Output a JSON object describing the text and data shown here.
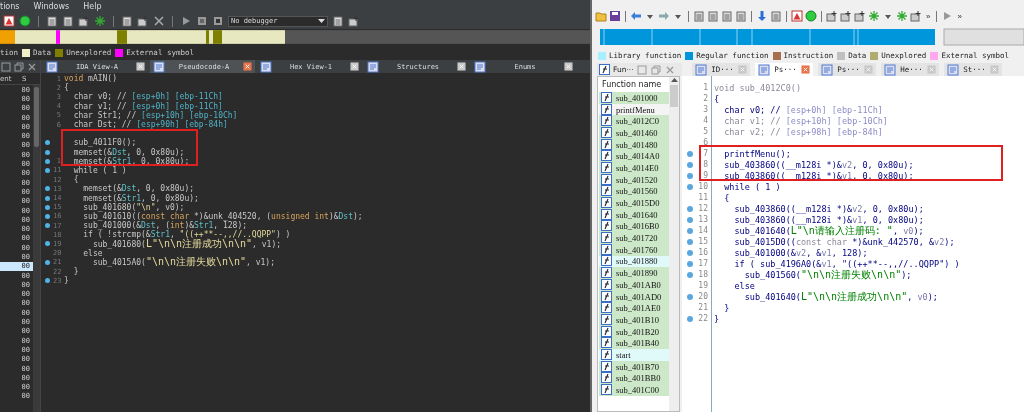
{
  "left_window": {
    "menu": [
      "tions",
      "Windows",
      "Help"
    ],
    "debugger": {
      "value": "No debugger"
    },
    "legend": [
      {
        "label": "tion"
      },
      {
        "label": "Data",
        "color": "#f0f0c8"
      },
      {
        "label": "Unexplored",
        "color": "#808000"
      },
      {
        "label": "External symbol",
        "color": "#ff00ff"
      }
    ],
    "side_panel": {
      "columns": [
        "ent",
        "S"
      ],
      "rows": [
        {
          "text": "00",
          "selected": false
        },
        {
          "text": "00",
          "selected": false
        },
        {
          "text": "00",
          "selected": false
        },
        {
          "text": "00",
          "selected": false
        },
        {
          "text": "00",
          "selected": false
        },
        {
          "text": "00",
          "selected": false
        },
        {
          "text": "00",
          "selected": false
        },
        {
          "text": "00",
          "selected": false
        },
        {
          "text": "00",
          "selected": false
        },
        {
          "text": "00",
          "selected": false
        },
        {
          "text": "00",
          "selected": false
        },
        {
          "text": "00",
          "selected": false
        },
        {
          "text": "00",
          "selected": false
        },
        {
          "text": "00",
          "selected": false
        },
        {
          "text": "00",
          "selected": false
        },
        {
          "text": "00",
          "selected": false
        },
        {
          "text": "00",
          "selected": false
        },
        {
          "text": "00",
          "selected": false
        },
        {
          "text": "00",
          "selected": false
        },
        {
          "text": "00",
          "selected": true
        },
        {
          "text": "00",
          "selected": false
        },
        {
          "text": "00",
          "selected": false
        },
        {
          "text": "00",
          "selected": false
        },
        {
          "text": "00",
          "selected": false
        },
        {
          "text": "00",
          "selected": false
        },
        {
          "text": "00",
          "selected": false
        },
        {
          "text": "00",
          "selected": false
        },
        {
          "text": "00",
          "selected": false
        },
        {
          "text": "00",
          "selected": false
        },
        {
          "text": "00",
          "selected": false
        },
        {
          "text": "00",
          "selected": false
        },
        {
          "text": "00",
          "selected": false
        },
        {
          "text": "00",
          "selected": false
        },
        {
          "text": "00",
          "selected": false
        }
      ]
    },
    "tabs": [
      {
        "label": "IDA View-A",
        "selected": false
      },
      {
        "label": "Pseudocode-A",
        "selected": true
      },
      {
        "label": "Hex View-1",
        "selected": false
      },
      {
        "label": "Structures",
        "selected": false
      },
      {
        "label": "Enums",
        "selected": false
      }
    ],
    "code": [
      {
        "no": "1",
        "dot": false,
        "boxed": false,
        "segs": [
          {
            "kind": "kw",
            "text": "void"
          },
          {
            "kind": "p",
            "text": " mAIN()"
          }
        ]
      },
      {
        "no": "2",
        "dot": false,
        "boxed": false,
        "segs": [
          {
            "kind": "p",
            "text": "{"
          }
        ]
      },
      {
        "no": "3",
        "dot": false,
        "boxed": false,
        "segs": [
          {
            "kind": "p",
            "text": "  char v0; // "
          },
          {
            "kind": "cm",
            "text": "[esp+0h] [ebp-11Ch]"
          }
        ]
      },
      {
        "no": "4",
        "dot": false,
        "boxed": false,
        "segs": [
          {
            "kind": "p",
            "text": "  char v1; // "
          },
          {
            "kind": "cm",
            "text": "[esp+0h] [ebp-11Ch]"
          }
        ]
      },
      {
        "no": "5",
        "dot": false,
        "boxed": false,
        "segs": [
          {
            "kind": "p",
            "text": "  char Str1; // "
          },
          {
            "kind": "cm",
            "text": "[esp+10h] [ebp-10Ch]"
          }
        ]
      },
      {
        "no": "6",
        "dot": false,
        "boxed": false,
        "segs": [
          {
            "kind": "p",
            "text": "  char Dst; // "
          },
          {
            "kind": "cm",
            "text": "[esp+90h] [ebp-84h]"
          }
        ]
      },
      {
        "dot": false,
        "boxed": true
      },
      {
        "dot": true,
        "boxed": true,
        "segs": [
          {
            "kind": "p",
            "text": "  sub_4011F0();"
          }
        ]
      },
      {
        "dot": true,
        "boxed": true,
        "segs": [
          {
            "kind": "p",
            "text": "  memset(&"
          },
          {
            "kind": "v",
            "text": "Dst"
          },
          {
            "kind": "p",
            "text": ", 0, 0x80u);"
          }
        ]
      },
      {
        "no": "1",
        "dot": true,
        "boxed": true,
        "segs": [
          {
            "kind": "p",
            "text": "  memset(&"
          },
          {
            "kind": "v",
            "text": "Str1"
          },
          {
            "kind": "p",
            "text": ", 0, 0x80u);"
          }
        ]
      },
      {
        "no": "11",
        "dot": true,
        "boxed": false,
        "segs": [
          {
            "kind": "p",
            "text": "  while ( 1 )"
          }
        ]
      },
      {
        "no": "12",
        "dot": false,
        "boxed": false,
        "segs": [
          {
            "kind": "p",
            "text": "  {"
          }
        ]
      },
      {
        "no": "13",
        "dot": true,
        "boxed": false,
        "segs": [
          {
            "kind": "p",
            "text": "    memset(&"
          },
          {
            "kind": "v",
            "text": "Dst"
          },
          {
            "kind": "p",
            "text": ", 0, 0x80u);"
          }
        ]
      },
      {
        "no": "14",
        "dot": true,
        "boxed": false,
        "segs": [
          {
            "kind": "p",
            "text": "    memset(&"
          },
          {
            "kind": "v",
            "text": "Str1"
          },
          {
            "kind": "p",
            "text": ", 0, 0x80u);"
          }
        ]
      },
      {
        "no": "15",
        "dot": true,
        "boxed": false,
        "segs": [
          {
            "kind": "p",
            "text": "    sub_401680("
          },
          {
            "kind": "s",
            "text": "\"\\n\""
          },
          {
            "kind": "p",
            "text": ", v0);"
          }
        ]
      },
      {
        "no": "16",
        "dot": true,
        "boxed": false,
        "segs": [
          {
            "kind": "p",
            "text": "    sub_401610(("
          },
          {
            "kind": "kw",
            "text": "const char"
          },
          {
            "kind": "p",
            "text": " *)&unk_404520, ("
          },
          {
            "kind": "kw",
            "text": "unsigned int"
          },
          {
            "kind": "p",
            "text": ")&"
          },
          {
            "kind": "v",
            "text": "Dst"
          },
          {
            "kind": "p",
            "text": ");"
          }
        ]
      },
      {
        "no": "17",
        "dot": true,
        "boxed": false,
        "segs": [
          {
            "kind": "p",
            "text": "    sub_401000(&"
          },
          {
            "kind": "v",
            "text": "Dst"
          },
          {
            "kind": "p",
            "text": ", ("
          },
          {
            "kind": "kw",
            "text": "int"
          },
          {
            "kind": "p",
            "text": ")&"
          },
          {
            "kind": "v",
            "text": "Str1"
          },
          {
            "kind": "p",
            "text": ", 128);"
          }
        ]
      },
      {
        "no": "18",
        "dot": false,
        "boxed": false,
        "segs": [
          {
            "kind": "p",
            "text": "    if ( !strcmp(&"
          },
          {
            "kind": "v",
            "text": "Str1"
          },
          {
            "kind": "p",
            "text": ", "
          },
          {
            "kind": "s",
            "text": "\"((++**--,,//..QQPP\""
          },
          {
            "kind": "p",
            "text": ") )"
          }
        ]
      },
      {
        "no": "19",
        "dot": true,
        "boxed": false,
        "segs": [
          {
            "kind": "p",
            "text": "      sub_401680("
          },
          {
            "kind": "s",
            "text": "L\"\\n\\n注册成功\\n\\n\""
          },
          {
            "kind": "p",
            "text": ", v1);"
          }
        ]
      },
      {
        "no": "20",
        "dot": false,
        "boxed": false,
        "segs": [
          {
            "kind": "p",
            "text": "    else"
          }
        ]
      },
      {
        "no": "21",
        "dot": true,
        "boxed": false,
        "segs": [
          {
            "kind": "p",
            "text": "      sub_4015A0("
          },
          {
            "kind": "s",
            "text": "\"\\n\\n注册失败\\n\\n\""
          },
          {
            "kind": "p",
            "text": ", v1);"
          }
        ]
      },
      {
        "no": "22",
        "dot": false,
        "boxed": false,
        "segs": [
          {
            "kind": "p",
            "text": "  }"
          }
        ]
      },
      {
        "no": "23",
        "dot": true,
        "boxed": false,
        "segs": [
          {
            "kind": "p",
            "text": "}"
          }
        ]
      }
    ]
  },
  "right_window": {
    "toolbar_more": [
      "»",
      "»"
    ],
    "legend": [
      {
        "label": "Library function",
        "color": "#a8f0ff"
      },
      {
        "label": "Regular function",
        "color": "#0096dc"
      },
      {
        "label": "Instruction",
        "color": "#a86e50"
      },
      {
        "label": "Data",
        "color": "#c0c0c0"
      },
      {
        "label": "Unexplored",
        "color": "#b0ac70"
      },
      {
        "label": "External symbol",
        "color": "#ffa8f0"
      }
    ],
    "functions_panel": {
      "title": "Fun···",
      "column": "Function name",
      "items": [
        {
          "name": "sub_401000",
          "color": "#cde8c8"
        },
        {
          "name": "printfMenu",
          "color": "#f4f4f4"
        },
        {
          "name": "sub_4012C0",
          "color": "#cde8c8"
        },
        {
          "name": "sub_401460",
          "color": "#cde8c8"
        },
        {
          "name": "sub_401480",
          "color": "#cde8c8"
        },
        {
          "name": "sub_4014A0",
          "color": "#cde8c8"
        },
        {
          "name": "sub_4014E0",
          "color": "#cde8c8"
        },
        {
          "name": "sub_401520",
          "color": "#cde8c8"
        },
        {
          "name": "sub_401560",
          "color": "#cde8c8"
        },
        {
          "name": "sub_4015D0",
          "color": "#cde8c8"
        },
        {
          "name": "sub_401640",
          "color": "#cde8c8"
        },
        {
          "name": "sub_4016B0",
          "color": "#cde8c8"
        },
        {
          "name": "sub_401720",
          "color": "#cde8c8"
        },
        {
          "name": "sub_401760",
          "color": "#cde8c8"
        },
        {
          "name": "sub_401880",
          "color": "#e0fafa"
        },
        {
          "name": "sub_401890",
          "color": "#cde8c8"
        },
        {
          "name": "sub_401AB0",
          "color": "#cde8c8"
        },
        {
          "name": "sub_401AD0",
          "color": "#cde8c8"
        },
        {
          "name": "sub_401AE0",
          "color": "#cde8c8"
        },
        {
          "name": "sub_401B10",
          "color": "#cde8c8"
        },
        {
          "name": "sub_401B20",
          "color": "#cde8c8"
        },
        {
          "name": "sub_401B40",
          "color": "#cde8c8"
        },
        {
          "name": "start",
          "color": "#e0fafa"
        },
        {
          "name": "sub_401B70",
          "color": "#cde8c8"
        },
        {
          "name": "sub_401BB0",
          "color": "#cde8c8"
        },
        {
          "name": "sub_401C00",
          "color": "#cde8c8"
        }
      ]
    },
    "tabs": [
      {
        "label": "ID···",
        "selected": false
      },
      {
        "label": "Ps···",
        "selected": true
      },
      {
        "label": "Ps···",
        "selected": false
      },
      {
        "label": "He···",
        "selected": false
      },
      {
        "label": "St···",
        "selected": false
      }
    ],
    "code": [
      {
        "no": "1",
        "dot": false,
        "boxed": false,
        "segs": [
          {
            "kind": "dim",
            "text": "void sub_4012C0()"
          }
        ]
      },
      {
        "no": "2",
        "dot": false,
        "boxed": false,
        "segs": [
          {
            "kind": "p",
            "text": "{"
          }
        ]
      },
      {
        "no": "3",
        "dot": false,
        "boxed": false,
        "segs": [
          {
            "kind": "p",
            "text": "  char v0; // "
          },
          {
            "kind": "cm",
            "text": "[esp+0h] [ebp-11Ch]"
          }
        ]
      },
      {
        "no": "4",
        "dot": false,
        "boxed": false,
        "segs": [
          {
            "kind": "dim",
            "text": "  char v1; // "
          },
          {
            "kind": "cm",
            "text": "[esp+10h] [ebp-10Ch]"
          }
        ]
      },
      {
        "no": "5",
        "dot": false,
        "boxed": false,
        "segs": [
          {
            "kind": "dim",
            "text": "  char v2; // "
          },
          {
            "kind": "cm",
            "text": "[esp+98h] [ebp-84h]"
          }
        ]
      },
      {
        "no": "6",
        "dot": false,
        "boxed": false
      },
      {
        "no": "7",
        "dot": true,
        "boxed": true,
        "segs": [
          {
            "kind": "p",
            "text": "  printfMenu();"
          }
        ]
      },
      {
        "no": "8",
        "dot": true,
        "boxed": true,
        "segs": [
          {
            "kind": "p",
            "text": "  sub_403860((__m128i *)&"
          },
          {
            "kind": "v",
            "text": "v2"
          },
          {
            "kind": "p",
            "text": ", 0, 0x80u);"
          }
        ]
      },
      {
        "no": "9",
        "dot": true,
        "boxed": true,
        "segs": [
          {
            "kind": "p",
            "text": "  sub_403860((__m128i *)&"
          },
          {
            "kind": "v",
            "text": "v1"
          },
          {
            "kind": "p",
            "text": ", 0, 0x80u);"
          }
        ]
      },
      {
        "no": "10",
        "dot": true,
        "boxed": false,
        "segs": [
          {
            "kind": "p",
            "text": "  while ( 1 )"
          }
        ]
      },
      {
        "no": "11",
        "dot": false,
        "boxed": false,
        "segs": [
          {
            "kind": "p",
            "text": "  {"
          }
        ]
      },
      {
        "no": "12",
        "dot": true,
        "boxed": false,
        "segs": [
          {
            "kind": "p",
            "text": "    sub_403860((__m128i *)&"
          },
          {
            "kind": "v",
            "text": "v2"
          },
          {
            "kind": "p",
            "text": ", 0, 0x80u);"
          }
        ]
      },
      {
        "no": "13",
        "dot": true,
        "boxed": false,
        "segs": [
          {
            "kind": "p",
            "text": "    sub_403860((__m128i *)&"
          },
          {
            "kind": "v",
            "text": "v1"
          },
          {
            "kind": "p",
            "text": ", 0, 0x80u);"
          }
        ]
      },
      {
        "no": "14",
        "dot": true,
        "boxed": false,
        "segs": [
          {
            "kind": "p",
            "text": "    sub_401640("
          },
          {
            "kind": "s",
            "text": "L\"\\n请输入注册码: \""
          },
          {
            "kind": "p",
            "text": ", "
          },
          {
            "kind": "v",
            "text": "v0"
          },
          {
            "kind": "p",
            "text": ");"
          }
        ]
      },
      {
        "no": "15",
        "dot": true,
        "boxed": false,
        "segs": [
          {
            "kind": "p",
            "text": "    sub_4015D0(("
          },
          {
            "kind": "kw",
            "text": "const char"
          },
          {
            "kind": "p",
            "text": " *)&unk_442570, &"
          },
          {
            "kind": "v",
            "text": "v2"
          },
          {
            "kind": "p",
            "text": ");"
          }
        ]
      },
      {
        "no": "16",
        "dot": true,
        "boxed": false,
        "segs": [
          {
            "kind": "p",
            "text": "    sub_401000(&"
          },
          {
            "kind": "v",
            "text": "v2"
          },
          {
            "kind": "p",
            "text": ", &"
          },
          {
            "kind": "v",
            "text": "v1"
          },
          {
            "kind": "p",
            "text": ", 128);"
          }
        ]
      },
      {
        "no": "17",
        "dot": true,
        "boxed": false,
        "segs": [
          {
            "kind": "p",
            "text": "    if ( sub_4196A0(&"
          },
          {
            "kind": "v",
            "text": "v1"
          },
          {
            "kind": "p",
            "text": ", \"((++**--,,//..QQPP\") )"
          }
        ]
      },
      {
        "no": "18",
        "dot": true,
        "boxed": false,
        "segs": [
          {
            "kind": "p",
            "text": "      sub_401560("
          },
          {
            "kind": "s",
            "text": "\"\\n\\n注册失败\\n\\n\""
          },
          {
            "kind": "p",
            "text": ");"
          }
        ]
      },
      {
        "no": "19",
        "dot": false,
        "boxed": false,
        "segs": [
          {
            "kind": "p",
            "text": "    else"
          }
        ]
      },
      {
        "no": "20",
        "dot": true,
        "boxed": false,
        "segs": [
          {
            "kind": "p",
            "text": "      sub_401640("
          },
          {
            "kind": "s",
            "text": "L\"\\n\\n注册成功\\n\\n\""
          },
          {
            "kind": "p",
            "text": ", "
          },
          {
            "kind": "v",
            "text": "v0"
          },
          {
            "kind": "p",
            "text": ");"
          }
        ]
      },
      {
        "no": "21",
        "dot": false,
        "boxed": false,
        "segs": [
          {
            "kind": "p",
            "text": "  }"
          }
        ]
      },
      {
        "no": "22",
        "dot": true,
        "boxed": false,
        "segs": [
          {
            "kind": "p",
            "text": "}"
          }
        ]
      }
    ]
  }
}
